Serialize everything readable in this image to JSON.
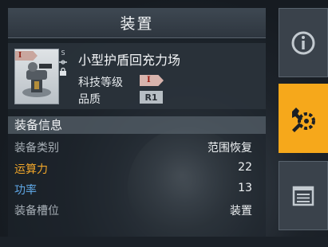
{
  "header": {
    "title": "装置"
  },
  "item": {
    "name": "小型护盾回充力场",
    "tier_badge": "I",
    "tech_level_label": "科技等级",
    "tech_level_badge": "I",
    "quality_label": "品质",
    "quality_value": "R1",
    "side_mark": "S"
  },
  "section": {
    "title": "装备信息"
  },
  "stats": [
    {
      "key": "装备类别",
      "value": "范围恢复",
      "color": "gray"
    },
    {
      "key": "运算力",
      "value": "22",
      "color": "orange"
    },
    {
      "key": "功率",
      "value": "13",
      "color": "blue"
    },
    {
      "key": "装备槽位",
      "value": "装置",
      "color": "gray"
    }
  ],
  "tabs": [
    {
      "icon": "info-icon",
      "active": false
    },
    {
      "icon": "gear-wrench-icon",
      "active": true
    },
    {
      "icon": "list-icon",
      "active": false
    }
  ],
  "colors": {
    "accent": "#f6a81b",
    "orange_text": "#f0a62a",
    "blue_text": "#5fa8e6"
  }
}
